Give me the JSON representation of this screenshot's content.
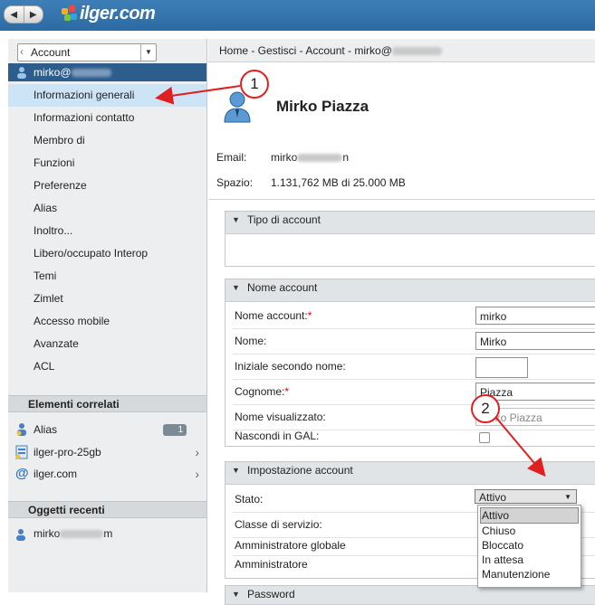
{
  "brand": {
    "logo_text": "ilger.com"
  },
  "nav_buttons": {
    "back": "◀",
    "forward": "▶"
  },
  "left": {
    "account_select": "Account",
    "current_account": "mirko@",
    "items": [
      {
        "label": "Informazioni generali",
        "selected": true
      },
      {
        "label": "Informazioni contatto"
      },
      {
        "label": "Membro di"
      },
      {
        "label": "Funzioni"
      },
      {
        "label": "Preferenze"
      },
      {
        "label": "Alias"
      },
      {
        "label": "Inoltro..."
      },
      {
        "label": "Libero/occupato Interop"
      },
      {
        "label": "Temi"
      },
      {
        "label": "Zimlet"
      },
      {
        "label": "Accesso mobile"
      },
      {
        "label": "Avanzate"
      },
      {
        "label": "ACL"
      }
    ],
    "related_header": "Elementi correlati",
    "related": [
      {
        "label": "Alias",
        "badge": "1",
        "icon": "alias-icon"
      },
      {
        "label": "ilger-pro-25gb",
        "icon": "cos-icon"
      },
      {
        "label": "ilger.com",
        "icon": "domain-at-icon"
      }
    ],
    "recent_header": "Oggetti recenti",
    "recent_item": "mirko",
    "recent_item_suffix": "m"
  },
  "main": {
    "breadcrumb": "Home - Gestisci - Account - mirko@",
    "full_name": "Mirko Piazza",
    "email_label": "Email:",
    "email_value": "mirko",
    "email_suffix": "n",
    "space_label": "Spazio:",
    "space_value": "1.131,762 MB di 25.000 MB",
    "panel_tipo": "Tipo di account",
    "panel_nome": "Nome account",
    "fields": {
      "nome_account_label": "Nome account:",
      "nome_account_value": "mirko",
      "nome_label": "Nome:",
      "nome_value": "Mirko",
      "iniziale_label": "Iniziale secondo nome:",
      "iniziale_value": "",
      "cognome_label": "Cognome:",
      "cognome_value": "Piazza",
      "visualizzato_label": "Nome visualizzato:",
      "visualizzato_value": "Mirko Piazza",
      "nascondi_label": "Nascondi in GAL:"
    },
    "panel_impostazione": "Impostazione account",
    "stato_label": "Stato:",
    "stato_value": "Attivo",
    "stato_options": [
      "Attivo",
      "Chiuso",
      "Bloccato",
      "In attesa",
      "Manutenzione"
    ],
    "classe_label": "Classe di servizio:",
    "admin_globale_label": "Amministratore globale",
    "admin_label": "Amministratore",
    "panel_password": "Password"
  },
  "callouts": [
    "1",
    "2"
  ],
  "colors": {
    "topbar": "#3f7fb7",
    "selected_account": "#2d5d8c",
    "annotation": "#e02020"
  }
}
